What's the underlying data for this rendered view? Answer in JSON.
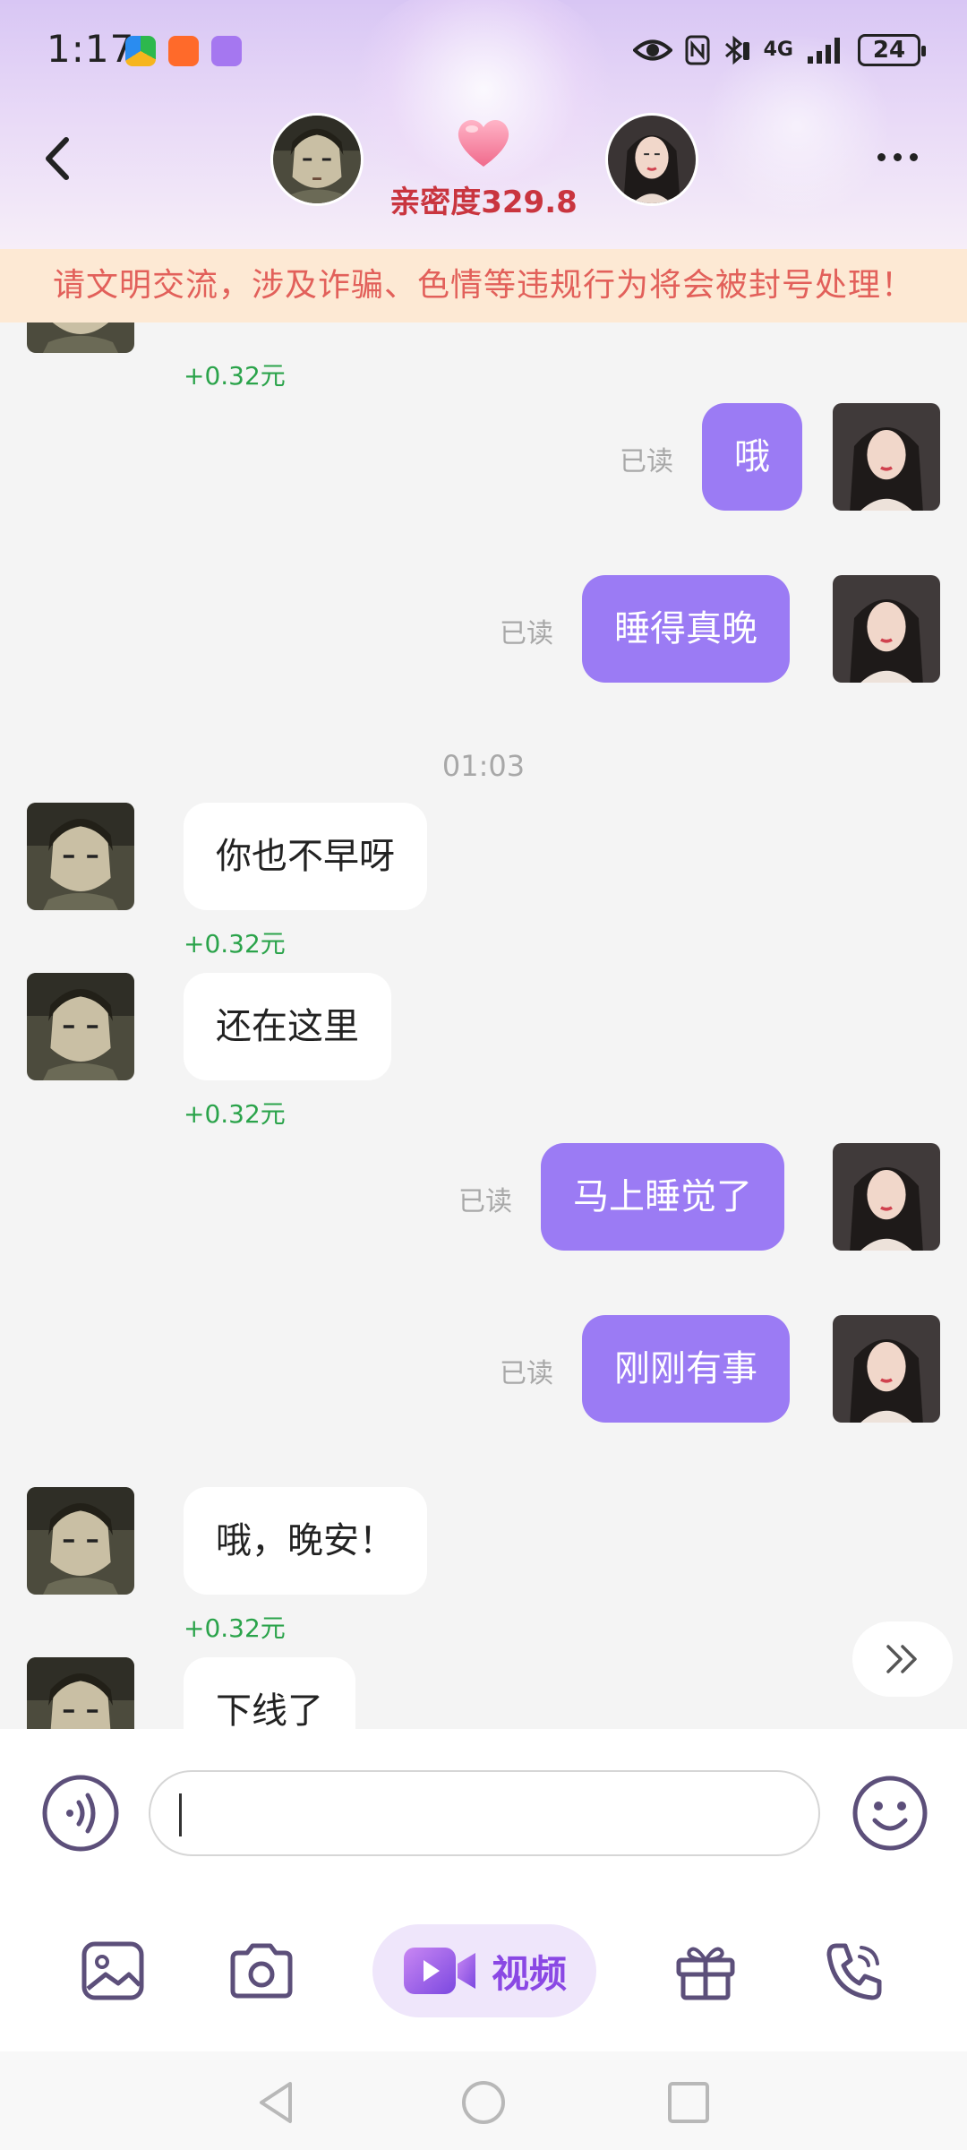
{
  "status_bar": {
    "time": "1:17",
    "network": "4G",
    "battery": "24"
  },
  "header": {
    "intimacy_text": "亲密度329.8"
  },
  "warning_banner": {
    "text": "请文明交流，涉及诈骗、色情等违规行为将会被封号处理！"
  },
  "chat": {
    "timestamp": "01:03",
    "earned_label": "+0.32元",
    "read_label": "已读",
    "messages": [
      {
        "side": "out",
        "text": "哦"
      },
      {
        "side": "out",
        "text": "睡得真晚"
      },
      {
        "side": "in",
        "text": "你也不早呀"
      },
      {
        "side": "in",
        "text": "还在这里"
      },
      {
        "side": "out",
        "text": "马上睡觉了"
      },
      {
        "side": "out",
        "text": "刚刚有事"
      },
      {
        "side": "in",
        "text": "哦，晚安！"
      },
      {
        "side": "in",
        "text": "下线了"
      }
    ]
  },
  "toolbar": {
    "video_label": "视频"
  },
  "colors": {
    "accent": "#9b7bf4",
    "earn_green": "#2aa34a",
    "warning_text": "#e2605a",
    "warning_bg": "#fde9d4",
    "intimacy_red": "#c9353f"
  },
  "icons": {
    "back": "chevron-left-icon",
    "more": "more-dots-icon",
    "heart": "heart-icon",
    "voice": "voice-icon",
    "emoji": "emoji-icon",
    "image": "image-icon",
    "camera": "camera-icon",
    "video": "video-camera-icon",
    "gift": "gift-icon",
    "phone": "phone-icon",
    "skip": "double-chevron-right-icon"
  }
}
